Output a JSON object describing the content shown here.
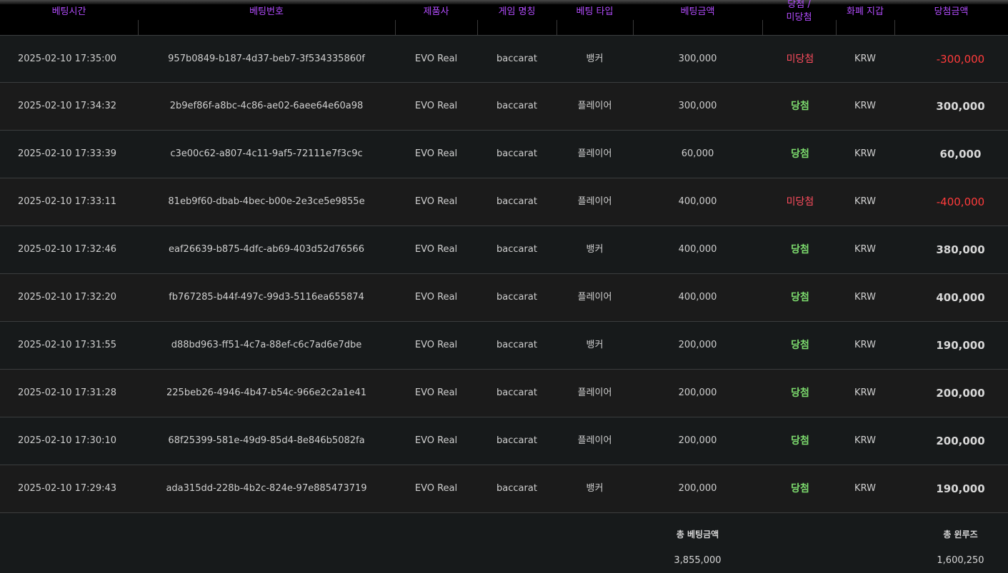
{
  "colors": {
    "header_text": "#b44dff",
    "win": "#7ddc6e",
    "lose": "#ff4d5e",
    "negative_amount": "#ff3b3b"
  },
  "headers": {
    "bet_time": "베팅시간",
    "bet_id": "베팅번호",
    "provider": "제품사",
    "game_name": "게임 명칭",
    "bet_type": "베팅 타입",
    "bet_amount": "베팅금액",
    "result": "당첨 /\n미당첨",
    "currency": "화폐 지갑",
    "win_amount": "당첨금액"
  },
  "rows": [
    {
      "time": "2025-02-10 17:35:00",
      "id": "957b0849-b187-4d37-beb7-3f534335860f",
      "provider": "EVO Real",
      "game": "baccarat",
      "type": "뱅커",
      "amount": "300,000",
      "result": "미당첨",
      "currency": "KRW",
      "win_amount": "-300,000"
    },
    {
      "time": "2025-02-10 17:34:32",
      "id": "2b9ef86f-a8bc-4c86-ae02-6aee64e60a98",
      "provider": "EVO Real",
      "game": "baccarat",
      "type": "플레이어",
      "amount": "300,000",
      "result": "당첨",
      "currency": "KRW",
      "win_amount": "300,000"
    },
    {
      "time": "2025-02-10 17:33:39",
      "id": "c3e00c62-a807-4c11-9af5-72111e7f3c9c",
      "provider": "EVO Real",
      "game": "baccarat",
      "type": "플레이어",
      "amount": "60,000",
      "result": "당첨",
      "currency": "KRW",
      "win_amount": "60,000"
    },
    {
      "time": "2025-02-10 17:33:11",
      "id": "81eb9f60-dbab-4bec-b00e-2e3ce5e9855e",
      "provider": "EVO Real",
      "game": "baccarat",
      "type": "플레이어",
      "amount": "400,000",
      "result": "미당첨",
      "currency": "KRW",
      "win_amount": "-400,000"
    },
    {
      "time": "2025-02-10 17:32:46",
      "id": "eaf26639-b875-4dfc-ab69-403d52d76566",
      "provider": "EVO Real",
      "game": "baccarat",
      "type": "뱅커",
      "amount": "400,000",
      "result": "당첨",
      "currency": "KRW",
      "win_amount": "380,000"
    },
    {
      "time": "2025-02-10 17:32:20",
      "id": "fb767285-b44f-497c-99d3-5116ea655874",
      "provider": "EVO Real",
      "game": "baccarat",
      "type": "플레이어",
      "amount": "400,000",
      "result": "당첨",
      "currency": "KRW",
      "win_amount": "400,000"
    },
    {
      "time": "2025-02-10 17:31:55",
      "id": "d88bd963-ff51-4c7a-88ef-c6c7ad6e7dbe",
      "provider": "EVO Real",
      "game": "baccarat",
      "type": "뱅커",
      "amount": "200,000",
      "result": "당첨",
      "currency": "KRW",
      "win_amount": "190,000"
    },
    {
      "time": "2025-02-10 17:31:28",
      "id": "225beb26-4946-4b47-b54c-966e2c2a1e41",
      "provider": "EVO Real",
      "game": "baccarat",
      "type": "플레이어",
      "amount": "200,000",
      "result": "당첨",
      "currency": "KRW",
      "win_amount": "200,000"
    },
    {
      "time": "2025-02-10 17:30:10",
      "id": "68f25399-581e-49d9-85d4-8e846b5082fa",
      "provider": "EVO Real",
      "game": "baccarat",
      "type": "플레이어",
      "amount": "200,000",
      "result": "당첨",
      "currency": "KRW",
      "win_amount": "200,000"
    },
    {
      "time": "2025-02-10 17:29:43",
      "id": "ada315dd-228b-4b2c-824e-97e885473719",
      "provider": "EVO Real",
      "game": "baccarat",
      "type": "뱅커",
      "amount": "200,000",
      "result": "당첨",
      "currency": "KRW",
      "win_amount": "190,000"
    }
  ],
  "footer": {
    "total_bet_label": "총 베팅금액",
    "total_bet_value": "3,855,000",
    "total_winloss_label": "총 윈루즈",
    "total_winloss_value": "1,600,250"
  }
}
